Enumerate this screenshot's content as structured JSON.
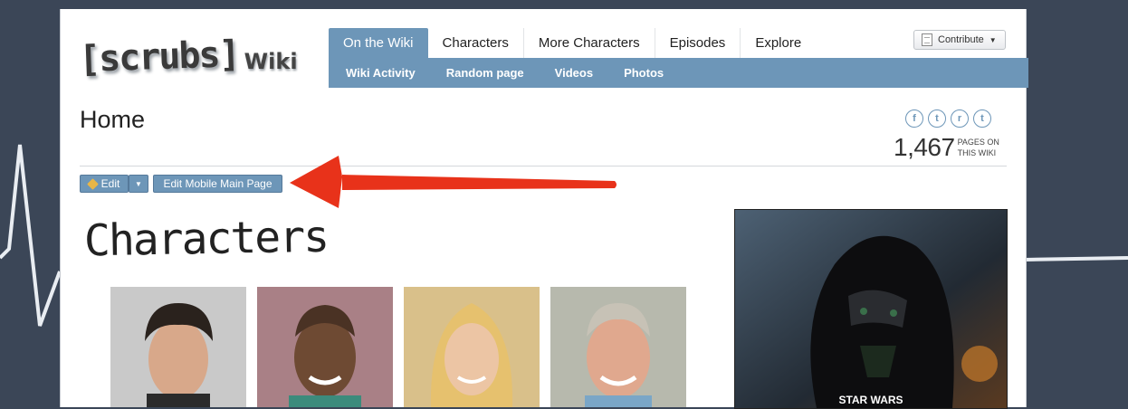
{
  "logo": {
    "brand": "[scrubs]",
    "suffix": "Wiki"
  },
  "nav": {
    "tabs": [
      {
        "label": "On the Wiki",
        "active": true
      },
      {
        "label": "Characters",
        "active": false
      },
      {
        "label": "More Characters",
        "active": false
      },
      {
        "label": "Episodes",
        "active": false
      },
      {
        "label": "Explore",
        "active": false
      }
    ],
    "subitems": [
      "Wiki Activity",
      "Random page",
      "Videos",
      "Photos"
    ]
  },
  "contribute": {
    "label": "Contribute"
  },
  "page": {
    "title": "Home"
  },
  "share": {
    "facebook_icon": "f",
    "twitter_icon": "t",
    "reddit_icon": "r",
    "tumblr_icon": "t"
  },
  "stats": {
    "count": "1,467",
    "label": "PAGES ON THIS WIKI"
  },
  "actions": {
    "edit_label": "Edit",
    "mobile_label": "Edit Mobile Main Page"
  },
  "content": {
    "heading": "Characters"
  },
  "ad": {
    "text": "STAR WARS"
  },
  "colors": {
    "accent": "#6d96b8",
    "background": "#3b4657",
    "arrow": "#e8321a"
  }
}
